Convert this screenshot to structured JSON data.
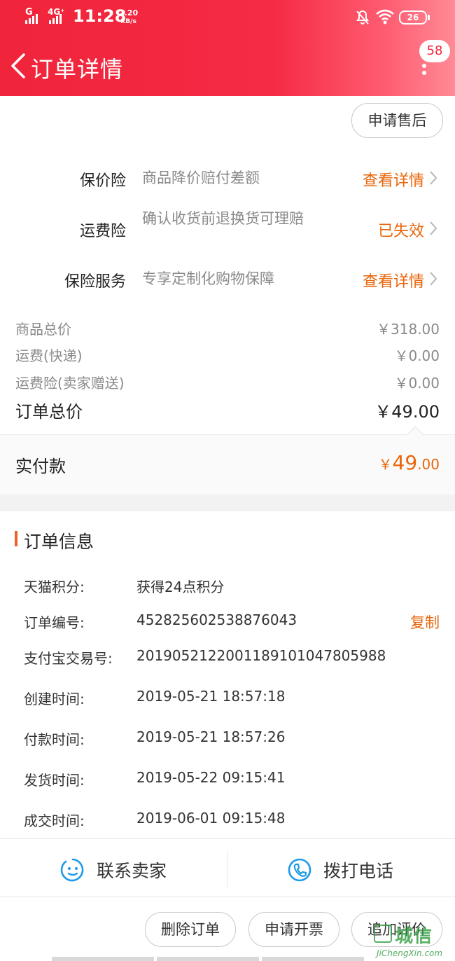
{
  "status_bar": {
    "signal_1_label": "G",
    "signal_2_label": "4G⁺",
    "time": "11:28",
    "speed_value": "2.20",
    "speed_unit": "KB/s",
    "battery": "26"
  },
  "nav": {
    "title": "订单详情",
    "message_count": "58"
  },
  "aftersale_button": "申请售后",
  "insurance": [
    {
      "name": "保价险",
      "desc": "商品降价赔付差额",
      "action": "查看详情"
    },
    {
      "name": "运费险",
      "desc": "确认收货前退换货可理赔",
      "action": "已失效"
    },
    {
      "name": "保险服务",
      "desc": "专享定制化购物保障",
      "action": "查看详情"
    }
  ],
  "prices": {
    "goods_label": "商品总价",
    "goods_value": "￥318.00",
    "shipping_label": "运费(快递)",
    "shipping_value": "￥0.00",
    "shipping_ins_label": "运费险(卖家赠送)",
    "shipping_ins_value": "￥0.00",
    "total_label": "订单总价",
    "total_value": "￥49.00",
    "paid_label": "实付款",
    "paid_currency": "￥",
    "paid_integer": "49",
    "paid_decimal": ".00"
  },
  "order_info": {
    "title": "订单信息",
    "rows": [
      {
        "label": "天猫积分:",
        "value": "获得24点积分"
      },
      {
        "label": "订单编号:",
        "value": "452825602538876043"
      },
      {
        "label": "支付宝交易号:",
        "value": "2019052122001189101047805988"
      },
      {
        "label": "创建时间:",
        "value": "2019-05-21 18:57:18"
      },
      {
        "label": "付款时间:",
        "value": "2019-05-21 18:57:26"
      },
      {
        "label": "发货时间:",
        "value": "2019-05-22 09:15:41"
      },
      {
        "label": "成交时间:",
        "value": "2019-06-01 09:15:48"
      }
    ],
    "copy_label": "复制"
  },
  "contact": {
    "seller_label": "联系卖家",
    "phone_label": "拨打电话"
  },
  "actions": {
    "delete_order": "删除订单",
    "request_invoice": "申请开票",
    "add_review": "追加评价"
  },
  "watermark": {
    "brand": "城信",
    "url": "JiChengXin.com"
  },
  "colors": {
    "header_red": "#f0243a",
    "accent_orange": "#e8650a"
  },
  "icons": [
    "back-chevron-icon",
    "more-icon",
    "bell-off-icon",
    "wifi-icon",
    "chevron-right-icon",
    "smiley-chat-icon",
    "phone-icon"
  ]
}
